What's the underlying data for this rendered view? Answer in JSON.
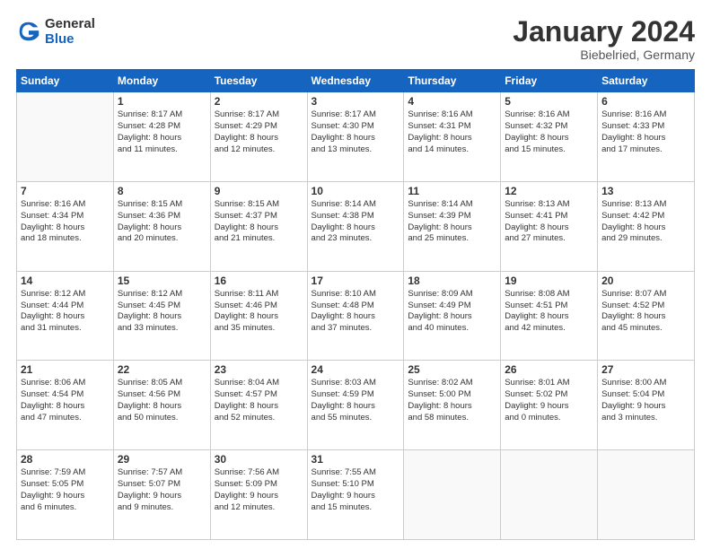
{
  "header": {
    "logo_general": "General",
    "logo_blue": "Blue",
    "month_title": "January 2024",
    "location": "Biebelried, Germany"
  },
  "weekdays": [
    "Sunday",
    "Monday",
    "Tuesday",
    "Wednesday",
    "Thursday",
    "Friday",
    "Saturday"
  ],
  "weeks": [
    [
      {
        "day": "",
        "text": ""
      },
      {
        "day": "1",
        "text": "Sunrise: 8:17 AM\nSunset: 4:28 PM\nDaylight: 8 hours\nand 11 minutes."
      },
      {
        "day": "2",
        "text": "Sunrise: 8:17 AM\nSunset: 4:29 PM\nDaylight: 8 hours\nand 12 minutes."
      },
      {
        "day": "3",
        "text": "Sunrise: 8:17 AM\nSunset: 4:30 PM\nDaylight: 8 hours\nand 13 minutes."
      },
      {
        "day": "4",
        "text": "Sunrise: 8:16 AM\nSunset: 4:31 PM\nDaylight: 8 hours\nand 14 minutes."
      },
      {
        "day": "5",
        "text": "Sunrise: 8:16 AM\nSunset: 4:32 PM\nDaylight: 8 hours\nand 15 minutes."
      },
      {
        "day": "6",
        "text": "Sunrise: 8:16 AM\nSunset: 4:33 PM\nDaylight: 8 hours\nand 17 minutes."
      }
    ],
    [
      {
        "day": "7",
        "text": "Sunrise: 8:16 AM\nSunset: 4:34 PM\nDaylight: 8 hours\nand 18 minutes."
      },
      {
        "day": "8",
        "text": "Sunrise: 8:15 AM\nSunset: 4:36 PM\nDaylight: 8 hours\nand 20 minutes."
      },
      {
        "day": "9",
        "text": "Sunrise: 8:15 AM\nSunset: 4:37 PM\nDaylight: 8 hours\nand 21 minutes."
      },
      {
        "day": "10",
        "text": "Sunrise: 8:14 AM\nSunset: 4:38 PM\nDaylight: 8 hours\nand 23 minutes."
      },
      {
        "day": "11",
        "text": "Sunrise: 8:14 AM\nSunset: 4:39 PM\nDaylight: 8 hours\nand 25 minutes."
      },
      {
        "day": "12",
        "text": "Sunrise: 8:13 AM\nSunset: 4:41 PM\nDaylight: 8 hours\nand 27 minutes."
      },
      {
        "day": "13",
        "text": "Sunrise: 8:13 AM\nSunset: 4:42 PM\nDaylight: 8 hours\nand 29 minutes."
      }
    ],
    [
      {
        "day": "14",
        "text": "Sunrise: 8:12 AM\nSunset: 4:44 PM\nDaylight: 8 hours\nand 31 minutes."
      },
      {
        "day": "15",
        "text": "Sunrise: 8:12 AM\nSunset: 4:45 PM\nDaylight: 8 hours\nand 33 minutes."
      },
      {
        "day": "16",
        "text": "Sunrise: 8:11 AM\nSunset: 4:46 PM\nDaylight: 8 hours\nand 35 minutes."
      },
      {
        "day": "17",
        "text": "Sunrise: 8:10 AM\nSunset: 4:48 PM\nDaylight: 8 hours\nand 37 minutes."
      },
      {
        "day": "18",
        "text": "Sunrise: 8:09 AM\nSunset: 4:49 PM\nDaylight: 8 hours\nand 40 minutes."
      },
      {
        "day": "19",
        "text": "Sunrise: 8:08 AM\nSunset: 4:51 PM\nDaylight: 8 hours\nand 42 minutes."
      },
      {
        "day": "20",
        "text": "Sunrise: 8:07 AM\nSunset: 4:52 PM\nDaylight: 8 hours\nand 45 minutes."
      }
    ],
    [
      {
        "day": "21",
        "text": "Sunrise: 8:06 AM\nSunset: 4:54 PM\nDaylight: 8 hours\nand 47 minutes."
      },
      {
        "day": "22",
        "text": "Sunrise: 8:05 AM\nSunset: 4:56 PM\nDaylight: 8 hours\nand 50 minutes."
      },
      {
        "day": "23",
        "text": "Sunrise: 8:04 AM\nSunset: 4:57 PM\nDaylight: 8 hours\nand 52 minutes."
      },
      {
        "day": "24",
        "text": "Sunrise: 8:03 AM\nSunset: 4:59 PM\nDaylight: 8 hours\nand 55 minutes."
      },
      {
        "day": "25",
        "text": "Sunrise: 8:02 AM\nSunset: 5:00 PM\nDaylight: 8 hours\nand 58 minutes."
      },
      {
        "day": "26",
        "text": "Sunrise: 8:01 AM\nSunset: 5:02 PM\nDaylight: 9 hours\nand 0 minutes."
      },
      {
        "day": "27",
        "text": "Sunrise: 8:00 AM\nSunset: 5:04 PM\nDaylight: 9 hours\nand 3 minutes."
      }
    ],
    [
      {
        "day": "28",
        "text": "Sunrise: 7:59 AM\nSunset: 5:05 PM\nDaylight: 9 hours\nand 6 minutes."
      },
      {
        "day": "29",
        "text": "Sunrise: 7:57 AM\nSunset: 5:07 PM\nDaylight: 9 hours\nand 9 minutes."
      },
      {
        "day": "30",
        "text": "Sunrise: 7:56 AM\nSunset: 5:09 PM\nDaylight: 9 hours\nand 12 minutes."
      },
      {
        "day": "31",
        "text": "Sunrise: 7:55 AM\nSunset: 5:10 PM\nDaylight: 9 hours\nand 15 minutes."
      },
      {
        "day": "",
        "text": ""
      },
      {
        "day": "",
        "text": ""
      },
      {
        "day": "",
        "text": ""
      }
    ]
  ]
}
